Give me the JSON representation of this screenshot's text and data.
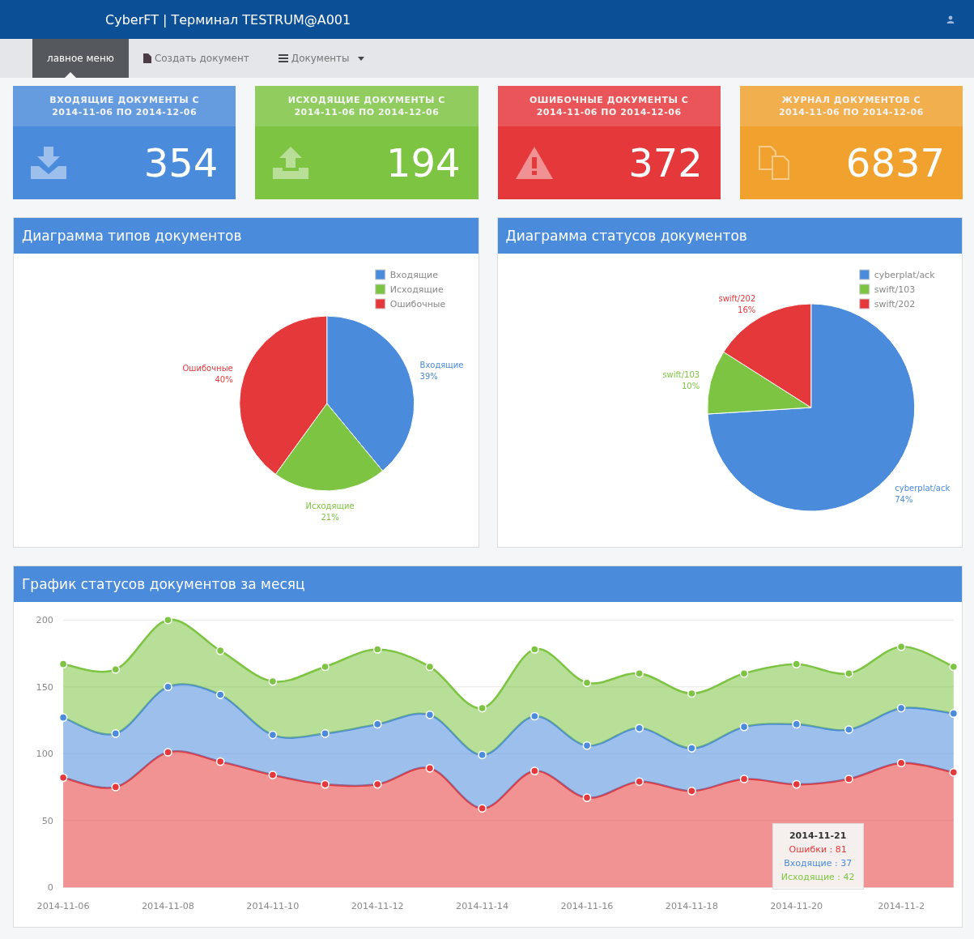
{
  "header": {
    "title": "CyberFT | Терминал TESTRUM@A001"
  },
  "nav": [
    {
      "label": "лавное меню",
      "kind": "plain",
      "selected": true
    },
    {
      "label": "Создать документ",
      "kind": "file",
      "selected": false
    },
    {
      "label": "Документы",
      "kind": "menu",
      "selected": false
    }
  ],
  "cards": [
    {
      "title": "ВХОДЯЩИЕ ДОКУМЕНТЫ С",
      "period": "2014-11-06 ПО 2014-12-06",
      "count": "354",
      "kind": "incoming",
      "color": "#4a8bdb"
    },
    {
      "title": "ИСХОДЯЩИЕ ДОКУМЕНТЫ С",
      "period": "2014-11-06 ПО 2014-12-06",
      "count": "194",
      "kind": "outgoing",
      "color": "#7ec443"
    },
    {
      "title": "ОШИБОЧНЫЕ ДОКУМЕНТЫ С",
      "period": "2014-11-06 ПО 2014-12-06",
      "count": "372",
      "kind": "error",
      "color": "#e5383b"
    },
    {
      "title": "ЖУРНАЛ ДОКУМЕНТОВ С",
      "period": "2014-11-06 ПО 2014-12-06",
      "count": "6837",
      "kind": "journal",
      "color": "#f0a12e"
    }
  ],
  "pie_panels": [
    {
      "title": "Диаграмма типов документов",
      "chart_data": {
        "type": "pie",
        "legend": true,
        "categories": [
          "Входящие",
          "Исходящие",
          "Ошибочные"
        ],
        "values": [
          39,
          21,
          40
        ],
        "value_labels": [
          "39%",
          "21%",
          "40%"
        ]
      }
    },
    {
      "title": "Диаграмма статусов документов",
      "chart_data": {
        "type": "pie",
        "legend": true,
        "categories": [
          "cyberplat/ack",
          "swift/103",
          "swift/202"
        ],
        "values": [
          74,
          10,
          16
        ],
        "value_labels": [
          "74%",
          "10%",
          "16%"
        ]
      }
    }
  ],
  "line_panel": {
    "title": "График статусов документов за месяц",
    "chart_data": {
      "type": "area",
      "stacked": true,
      "categories": [
        "2014-11-06",
        null,
        "2014-11-08",
        null,
        "2014-11-10",
        null,
        "2014-11-12",
        null,
        "2014-11-14",
        null,
        "2014-11-16",
        null,
        "2014-11-18",
        null,
        "2014-11-20",
        null,
        "2014-11-2",
        null
      ],
      "series": [
        {
          "color": "#e5383b",
          "values": [
            82,
            75,
            101,
            94,
            84,
            77,
            77,
            89,
            59,
            87,
            67,
            79,
            72,
            81,
            77,
            81,
            93,
            86
          ]
        },
        {
          "color": "#4a8bdb",
          "values": [
            45,
            40,
            49,
            50,
            30,
            38,
            45,
            40,
            40,
            41,
            39,
            40,
            32,
            39,
            45,
            37,
            41,
            44
          ]
        },
        {
          "color": "#7ec443",
          "values": [
            40,
            48,
            50,
            33,
            40,
            50,
            56,
            36,
            35,
            50,
            47,
            41,
            41,
            40,
            45,
            42,
            46,
            35
          ]
        }
      ],
      "ylim": [
        0,
        200
      ],
      "grid": true,
      "yticks": [
        0,
        50,
        100,
        150,
        200
      ],
      "annotations": [
        "2014-11-21"
      ]
    },
    "tooltip_lines": [
      "Ошибки : 81",
      "Входящие : 37",
      "Исходящие : 42"
    ]
  }
}
